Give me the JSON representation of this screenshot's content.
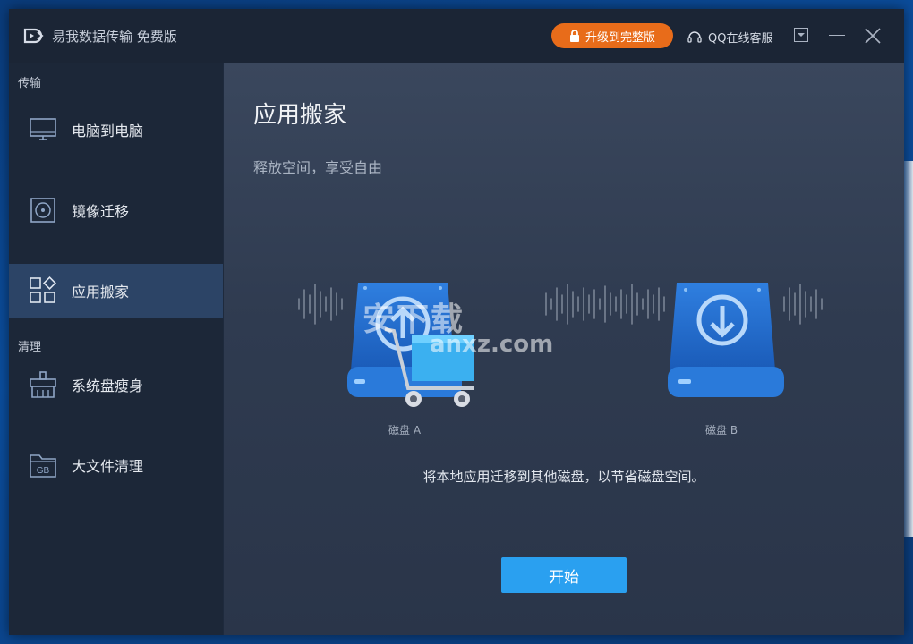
{
  "app": {
    "title": "易我数据传输 免费版"
  },
  "titlebar": {
    "upgrade_label": "升级到完整版",
    "support_label": "QQ在线客服"
  },
  "sidebar": {
    "sections": [
      {
        "label": "传输"
      },
      {
        "label": "清理"
      }
    ],
    "items": [
      {
        "label": "电脑到电脑",
        "icon": "monitor-icon"
      },
      {
        "label": "镜像迁移",
        "icon": "disc-icon"
      },
      {
        "label": "应用搬家",
        "icon": "apps-icon",
        "active": true
      },
      {
        "label": "系统盘瘦身",
        "icon": "broom-icon"
      },
      {
        "label": "大文件清理",
        "icon": "gb-folder-icon"
      }
    ],
    "gb_text": "GB"
  },
  "main": {
    "title": "应用搬家",
    "subtitle": "释放空间，享受自由",
    "disk_a_label": "磁盘 A",
    "disk_b_label": "磁盘 B",
    "description": "将本地应用迁移到其他磁盘，以节省磁盘空间。",
    "start_label": "开始",
    "watermark_text": "安下载",
    "watermark_sub": "anxz.com"
  },
  "colors": {
    "accent": "#2aa0f0",
    "upgrade": "#e86c1a",
    "active_nav": "#2c4466",
    "disk_blue": "#1f6fd1"
  }
}
